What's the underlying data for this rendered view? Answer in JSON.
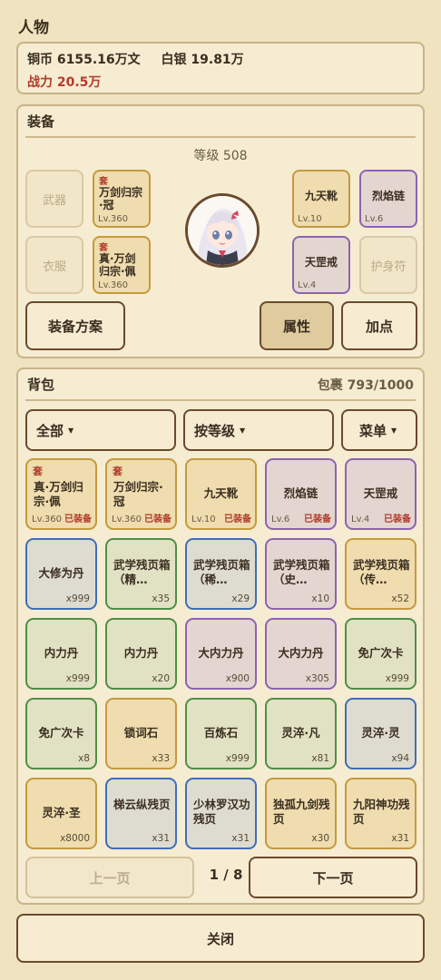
{
  "header": {
    "title": "人物"
  },
  "stats": {
    "copper": "铜币 6155.16万文",
    "silver": "白银 19.81万",
    "power": "战力 20.5万"
  },
  "equipment": {
    "title": "装备",
    "level": "等级 508",
    "empty_slots": {
      "weapon": "武器",
      "clothes": "衣服",
      "amulet": "护身符"
    },
    "slots": [
      {
        "tag": "套",
        "name": "万剑归宗·冠",
        "level": "Lv.360",
        "quality": "gold"
      },
      {
        "tag": "套",
        "name": "真·万剑归宗·佩",
        "level": "Lv.360",
        "quality": "gold"
      },
      {
        "tag": "",
        "name": "九天靴",
        "level": "Lv.10",
        "quality": "gold"
      },
      {
        "tag": "",
        "name": "烈焰链",
        "level": "Lv.6",
        "quality": "purple"
      },
      {
        "tag": "",
        "name": "天罡戒",
        "level": "Lv.4",
        "quality": "purple"
      }
    ],
    "buttons": {
      "plan": "装备方案",
      "attributes": "属性",
      "points": "加点"
    }
  },
  "bag": {
    "title": "背包",
    "capacity": "包裹 793/1000",
    "filters": {
      "category": "全部",
      "sort": "按等级",
      "menu": "菜单"
    },
    "items": [
      {
        "tag": "套",
        "name": "真·万剑归宗·佩",
        "level": "Lv.360",
        "equipped": "已装备",
        "count": "",
        "quality": "gold"
      },
      {
        "tag": "套",
        "name": "万剑归宗·冠",
        "level": "Lv.360",
        "equipped": "已装备",
        "count": "",
        "quality": "gold"
      },
      {
        "tag": "",
        "name": "九天靴",
        "level": "Lv.10",
        "equipped": "已装备",
        "count": "",
        "quality": "gold"
      },
      {
        "tag": "",
        "name": "烈焰链",
        "level": "Lv.6",
        "equipped": "已装备",
        "count": "",
        "quality": "purple"
      },
      {
        "tag": "",
        "name": "天罡戒",
        "level": "Lv.4",
        "equipped": "已装备",
        "count": "",
        "quality": "purple"
      },
      {
        "tag": "",
        "name": "大修为丹",
        "level": "",
        "equipped": "",
        "count": "x999",
        "quality": "blue"
      },
      {
        "tag": "",
        "name": "武学残页箱（精…",
        "level": "",
        "equipped": "",
        "count": "x35",
        "quality": "green"
      },
      {
        "tag": "",
        "name": "武学残页箱（稀…",
        "level": "",
        "equipped": "",
        "count": "x29",
        "quality": "blue"
      },
      {
        "tag": "",
        "name": "武学残页箱（史…",
        "level": "",
        "equipped": "",
        "count": "x10",
        "quality": "purple"
      },
      {
        "tag": "",
        "name": "武学残页箱（传…",
        "level": "",
        "equipped": "",
        "count": "x52",
        "quality": "gold"
      },
      {
        "tag": "",
        "name": "内力丹",
        "level": "",
        "equipped": "",
        "count": "x999",
        "quality": "green"
      },
      {
        "tag": "",
        "name": "内力丹",
        "level": "",
        "equipped": "",
        "count": "x20",
        "quality": "green"
      },
      {
        "tag": "",
        "name": "大内力丹",
        "level": "",
        "equipped": "",
        "count": "x900",
        "quality": "purple"
      },
      {
        "tag": "",
        "name": "大内力丹",
        "level": "",
        "equipped": "",
        "count": "x305",
        "quality": "purple"
      },
      {
        "tag": "",
        "name": "免广次卡",
        "level": "",
        "equipped": "",
        "count": "x999",
        "quality": "green"
      },
      {
        "tag": "",
        "name": "免广次卡",
        "level": "",
        "equipped": "",
        "count": "x8",
        "quality": "green"
      },
      {
        "tag": "",
        "name": "锁词石",
        "level": "",
        "equipped": "",
        "count": "x33",
        "quality": "gold"
      },
      {
        "tag": "",
        "name": "百炼石",
        "level": "",
        "equipped": "",
        "count": "x999",
        "quality": "green"
      },
      {
        "tag": "",
        "name": "灵淬·凡",
        "level": "",
        "equipped": "",
        "count": "x81",
        "quality": "green"
      },
      {
        "tag": "",
        "name": "灵淬·灵",
        "level": "",
        "equipped": "",
        "count": "x94",
        "quality": "blue"
      },
      {
        "tag": "",
        "name": "灵淬·圣",
        "level": "",
        "equipped": "",
        "count": "x8000",
        "quality": "gold"
      },
      {
        "tag": "",
        "name": "梯云纵残页",
        "level": "",
        "equipped": "",
        "count": "x31",
        "quality": "blue"
      },
      {
        "tag": "",
        "name": "少林罗汉功残页",
        "level": "",
        "equipped": "",
        "count": "x31",
        "quality": "blue"
      },
      {
        "tag": "",
        "name": "独孤九剑残页",
        "level": "",
        "equipped": "",
        "count": "x30",
        "quality": "gold"
      },
      {
        "tag": "",
        "name": "九阳神功残页",
        "level": "",
        "equipped": "",
        "count": "x31",
        "quality": "gold"
      }
    ],
    "pagination": {
      "prev": "上一页",
      "page": "1 / 8",
      "next": "下一页"
    }
  },
  "footer": {
    "close": "关闭"
  },
  "colors": {
    "background": "#f0e3bf",
    "power_red": "#b23b2a",
    "quality_gold": "#c49a3e",
    "quality_purple": "#8e63b0",
    "quality_blue": "#3f6fb5",
    "quality_green": "#4f8e48"
  }
}
